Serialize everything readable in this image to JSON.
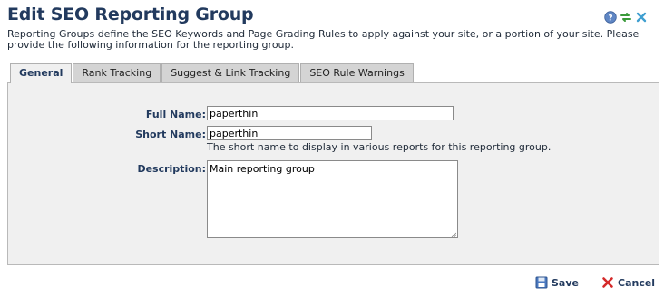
{
  "header": {
    "title": "Edit SEO Reporting Group",
    "icons": [
      "help-icon",
      "refresh-icon",
      "close-icon"
    ]
  },
  "intro": {
    "text": "Reporting Groups define the SEO Keywords and Page Grading Rules to apply against your site, or a portion of your site. Please provide the following information for the reporting group."
  },
  "tabs": [
    {
      "label": "General",
      "active": true
    },
    {
      "label": "Rank Tracking",
      "active": false
    },
    {
      "label": "Suggest & Link Tracking",
      "active": false
    },
    {
      "label": "SEO Rule Warnings",
      "active": false
    }
  ],
  "form": {
    "full_name": {
      "label": "Full Name:",
      "value": "paperthin"
    },
    "short_name": {
      "label": "Short Name:",
      "value": "paperthin",
      "hint": "The short name to display in various reports for this reporting group."
    },
    "description": {
      "label": "Description:",
      "value": "Main reporting group"
    }
  },
  "footer": {
    "save_label": "Save",
    "cancel_label": "Cancel"
  },
  "colors": {
    "title": "#223a5e",
    "panel_bg": "#f0f0f0",
    "tab_bg": "#d4d4d4"
  }
}
